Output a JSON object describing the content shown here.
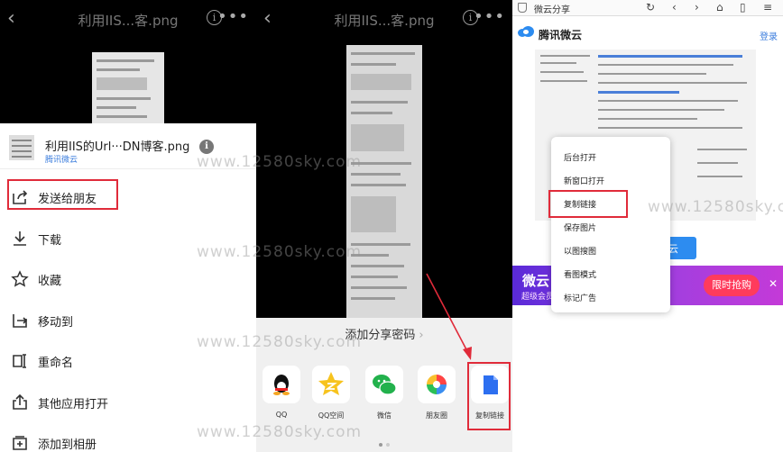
{
  "panel1": {
    "title": "利用IIS...客.png",
    "back_glyph": "‹",
    "info_glyph": "i",
    "more_glyph": "•••",
    "file_name": "利用IIS的Url···DN博客.png",
    "file_source": "腾讯微云",
    "menu": [
      {
        "label": "发送给朋友",
        "icon": "share-out-icon"
      },
      {
        "label": "下载",
        "icon": "download-icon"
      },
      {
        "label": "收藏",
        "icon": "star-icon"
      },
      {
        "label": "移动到",
        "icon": "move-icon"
      },
      {
        "label": "重命名",
        "icon": "rename-icon"
      },
      {
        "label": "其他应用打开",
        "icon": "open-with-icon"
      },
      {
        "label": "添加到相册",
        "icon": "add-album-icon"
      }
    ]
  },
  "panel2": {
    "title": "利用IIS...客.png",
    "back_glyph": "‹",
    "info_glyph": "i",
    "more_glyph": "•••",
    "password_label": "添加分享密码",
    "password_arrow": "›",
    "apps": [
      {
        "label": "QQ",
        "icon": "qq-icon"
      },
      {
        "label": "QQ空间",
        "icon": "qzone-icon"
      },
      {
        "label": "微信",
        "icon": "wechat-icon"
      },
      {
        "label": "朋友圈",
        "icon": "moments-icon"
      },
      {
        "label": "复制链接",
        "icon": "copy-link-icon"
      }
    ]
  },
  "panel3": {
    "tab_title": "微云分享",
    "brand": "腾讯微云",
    "login": "登录",
    "partial_button": "云",
    "promo_title": "微云",
    "promo_subtitle": "超级会员",
    "promo_button": "限时抢购",
    "promo_close": "✕",
    "context_menu": [
      "后台打开",
      "新窗口打开",
      "复制链接",
      "保存图片",
      "以图搜图",
      "看图模式",
      "标记广告"
    ]
  },
  "watermark": "www.12580sky.com",
  "colors": {
    "highlight": "#e02b3a",
    "link_blue": "#3b7ddd",
    "promo_pink": "#ff3b5c"
  }
}
